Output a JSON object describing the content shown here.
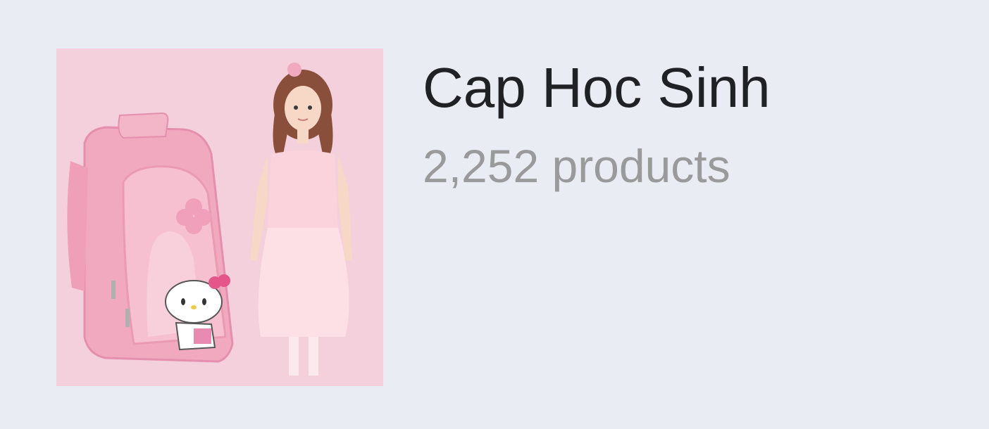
{
  "collection": {
    "title": "Cap Hoc Sinh",
    "product_count": "2,252 products",
    "thumbnail_icon": "product-image-backpack-girl-icon"
  },
  "colors": {
    "background": "#eaecf4",
    "title": "#202124",
    "subtitle": "#9a9a9a",
    "thumbnail_bg": "#f4cfdc"
  }
}
